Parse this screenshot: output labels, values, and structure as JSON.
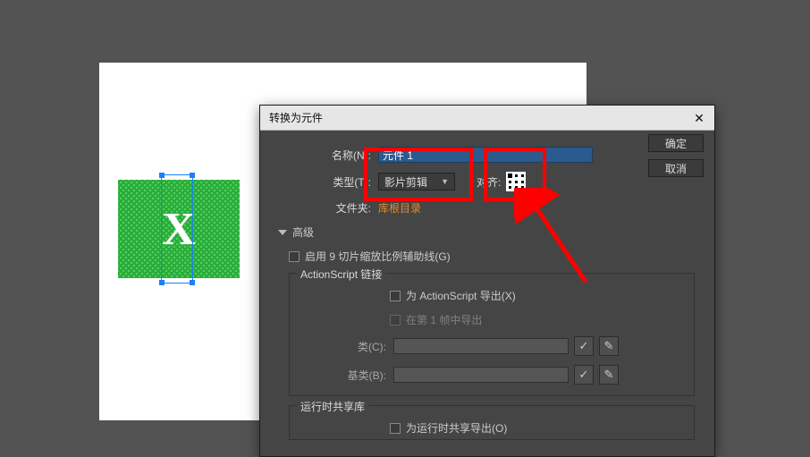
{
  "canvas": {
    "symbol_letter": "X"
  },
  "dialog": {
    "title": "转换为元件",
    "close_glyph": "✕",
    "labels": {
      "name": "名称(N):",
      "type": "类型(T):",
      "align": "对齐:",
      "folder": "文件夹:"
    },
    "name_value": "元件 1",
    "type_value": "影片剪辑",
    "folder_link": "库根目录",
    "advanced": {
      "label": "高级",
      "nine_slice": "启用 9 切片缩放比例辅助线(G)",
      "as_link": {
        "legend": "ActionScript 链接",
        "export_as": "为 ActionScript 导出(X)",
        "export_frame1": "在第 1 帧中导出",
        "class_label": "类(C):",
        "base_label": "基类(B):"
      },
      "runtime": {
        "legend": "运行时共享库",
        "export_runtime": "为运行时共享导出(O)"
      }
    },
    "buttons": {
      "ok": "确定",
      "cancel": "取消"
    },
    "icons": {
      "check": "✓",
      "pencil": "✎"
    }
  }
}
